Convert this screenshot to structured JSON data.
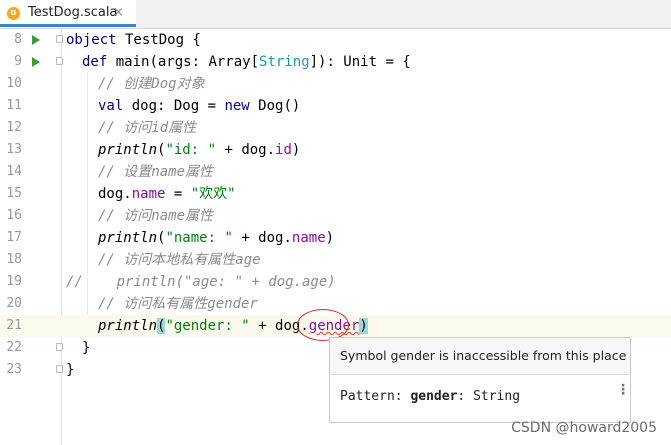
{
  "tab": {
    "label": "TestDog.scala",
    "icon_letter": "o",
    "close": "×"
  },
  "lines": [
    {
      "num": "8"
    },
    {
      "num": "9"
    },
    {
      "num": "10"
    },
    {
      "num": "11"
    },
    {
      "num": "12"
    },
    {
      "num": "13"
    },
    {
      "num": "14"
    },
    {
      "num": "15"
    },
    {
      "num": "16"
    },
    {
      "num": "17"
    },
    {
      "num": "18"
    },
    {
      "num": "19"
    },
    {
      "num": "20"
    },
    {
      "num": "21"
    },
    {
      "num": "22"
    },
    {
      "num": "23"
    }
  ],
  "code": {
    "l8": {
      "kw": "object",
      "rest": " TestDog {"
    },
    "l9": {
      "kw": "def",
      "a": " main(args: Array[",
      "type": "String",
      "b": "]): Unit = {"
    },
    "l10": {
      "comment": "// 创建Dog对象"
    },
    "l11": {
      "kw": "val",
      "a": " dog: Dog = ",
      "kw2": "new",
      "b": " Dog()"
    },
    "l12": {
      "comment": "// 访问id属性"
    },
    "l13": {
      "fn": "println",
      "a": "(",
      "str": "\"id: \"",
      "b": " + dog.",
      "fld": "id",
      "c": ")"
    },
    "l14": {
      "comment": "// 设置name属性"
    },
    "l15": {
      "a": "dog.",
      "fld": "name",
      "b": " = ",
      "str": "\"欢欢\""
    },
    "l16": {
      "comment": "// 访问name属性"
    },
    "l17": {
      "fn": "println",
      "a": "(",
      "str": "\"name: \"",
      "b": " + dog.",
      "fld": "name",
      "c": ")"
    },
    "l18": {
      "comment": "// 访问本地私有属性age"
    },
    "l19": {
      "slashes": "//",
      "rest": "    println(\"age: \" + dog.age)"
    },
    "l20": {
      "comment": "// 访问私有属性gender"
    },
    "l21": {
      "fn": "println",
      "open": "(",
      "str": "\"gender: \"",
      "b": " + dog.",
      "err": "gender",
      "close": ")"
    },
    "l22": {
      "text": "}"
    },
    "l23": {
      "text": "}"
    }
  },
  "tooltip": {
    "message": "Symbol gender is inaccessible from this place",
    "pattern_label": "Pattern: ",
    "pattern_name": "gender",
    "pattern_type": ": String",
    "menu": "⋮"
  },
  "watermark": "CSDN @howard2005",
  "colors": {
    "accent": "#4083c9",
    "run": "#3c9c3c",
    "error": "#e0272b",
    "keyword": "#000080",
    "string": "#067d17",
    "field": "#871094",
    "comment": "#8c8c8c"
  }
}
